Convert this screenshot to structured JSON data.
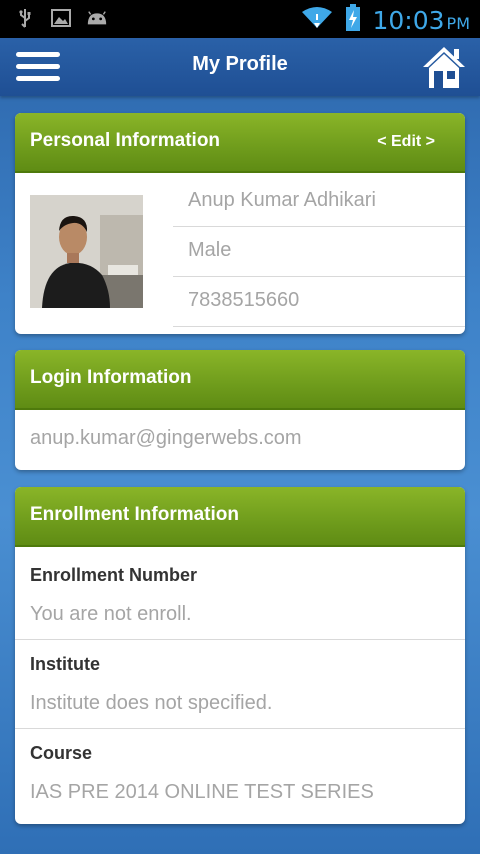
{
  "status_bar": {
    "time": "10:03",
    "ampm": "PM",
    "icons": [
      "usb-icon",
      "image-icon",
      "android-icon",
      "wifi-icon",
      "battery-charging-icon"
    ]
  },
  "app_bar": {
    "title": "My Profile",
    "menu_icon": "hamburger-menu-icon",
    "home_icon": "home-icon"
  },
  "personal": {
    "header": "Personal Information",
    "edit_label": "< Edit >",
    "name": "Anup Kumar Adhikari",
    "gender": "Male",
    "phone": "7838515660"
  },
  "login": {
    "header": "Login Information",
    "email": "anup.kumar@gingerwebs.com"
  },
  "enrollment": {
    "header": "Enrollment Information",
    "rows": [
      {
        "label": "Enrollment Number",
        "value": "You are not enroll."
      },
      {
        "label": "Institute",
        "value": "Institute does not specified."
      },
      {
        "label": "Course",
        "value": "IAS PRE 2014 ONLINE TEST SERIES"
      }
    ]
  },
  "colors": {
    "header_green": "#7aa622",
    "app_bar_blue": "#1f4f94",
    "status_blue": "#3fa8e8"
  }
}
